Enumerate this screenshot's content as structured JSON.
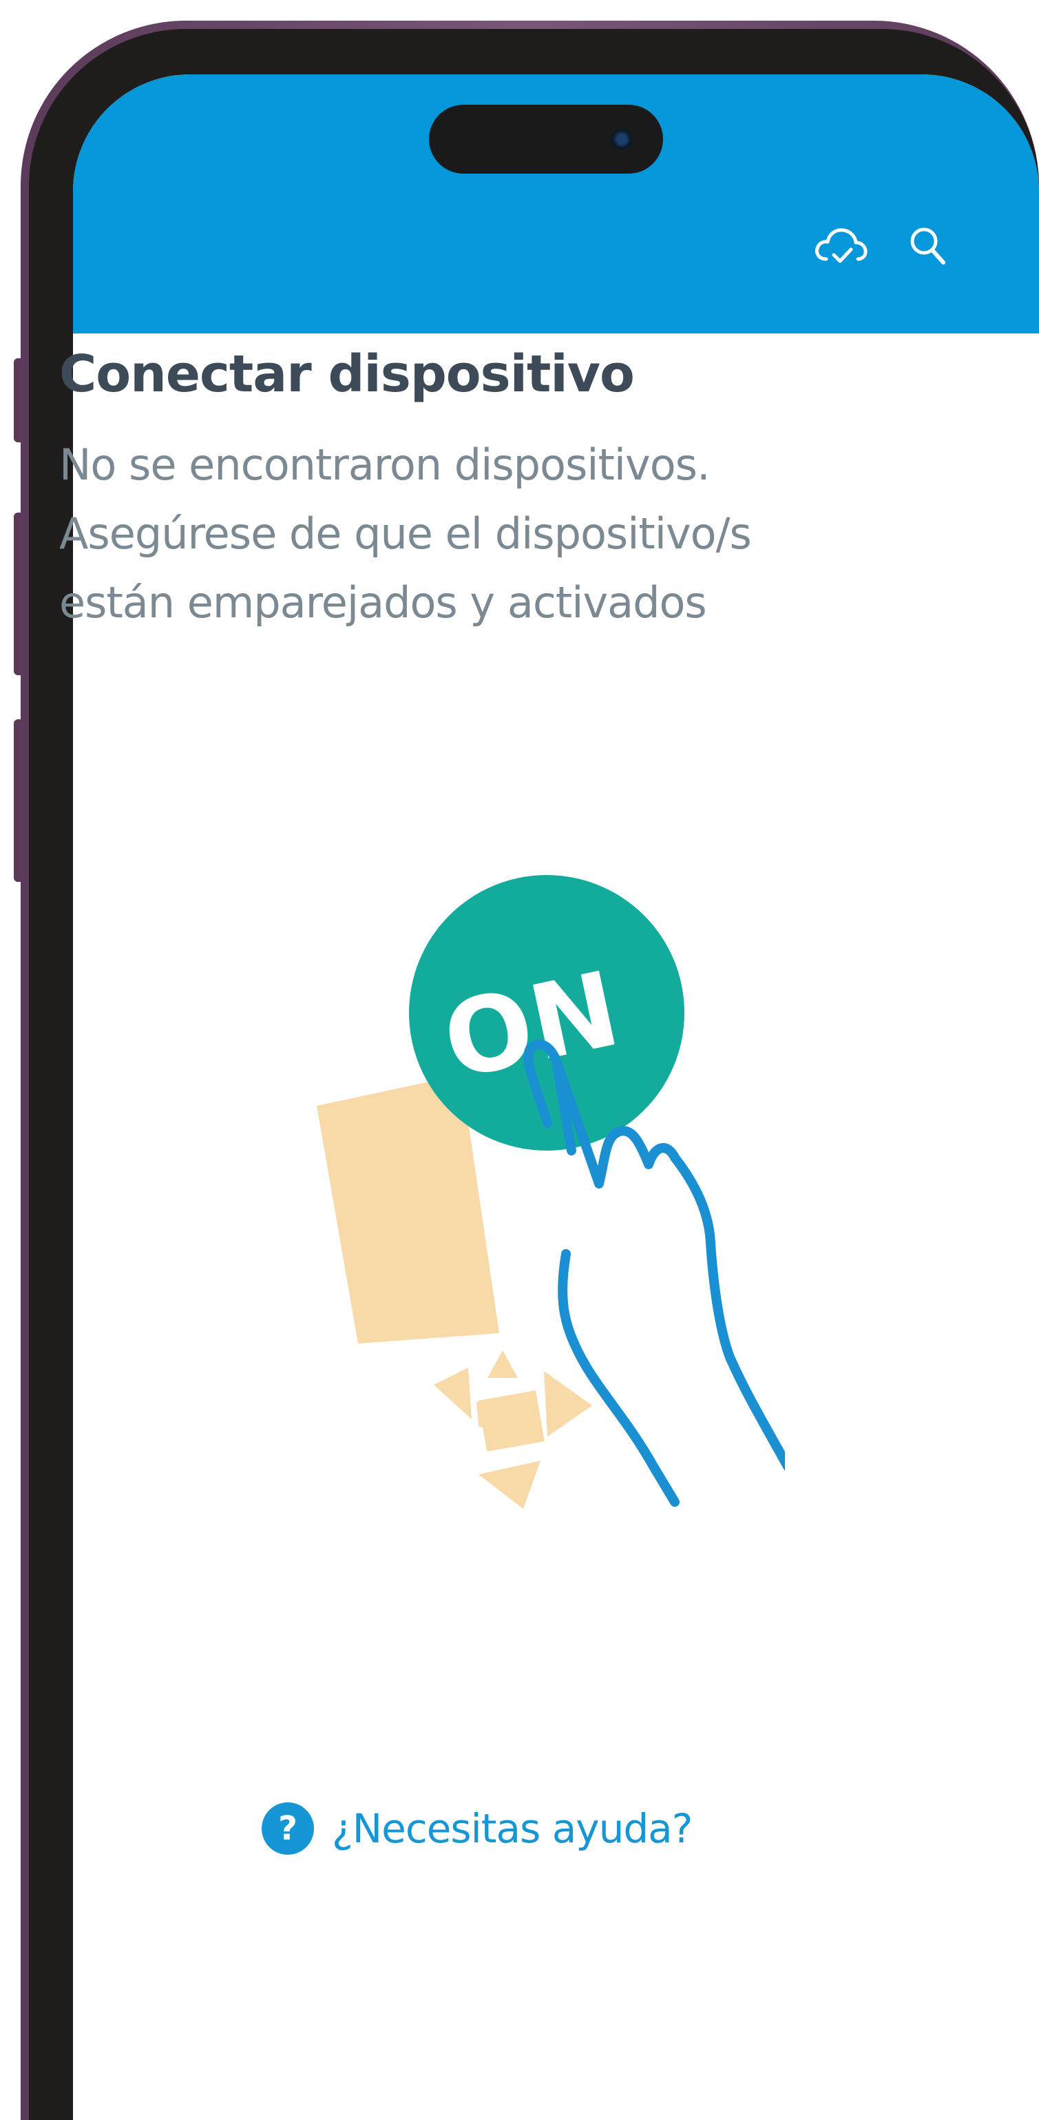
{
  "header": {
    "background_color": "#0497da",
    "icons": [
      "cloud-sync-icon",
      "search-icon"
    ]
  },
  "main": {
    "title": "Conectar dispositivo",
    "message_lines": [
      "No se encontraron dispositivos.",
      "Asegúrese de que el dispositivo/s",
      "están emparejados y activados"
    ]
  },
  "illustration": {
    "button_label": "ON",
    "colors": {
      "button": "#13ab9c",
      "device": "#f8d9a8",
      "hand": "#1a8fd1"
    }
  },
  "footer": {
    "help_icon": "?",
    "help_label": "¿Necesitas ayuda?"
  },
  "colors": {
    "title": "#3c4b57",
    "subtitle": "#7b8993",
    "link": "#1796d6"
  }
}
